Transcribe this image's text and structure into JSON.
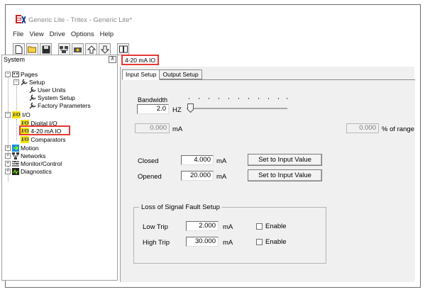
{
  "window": {
    "title": "Generic Lite - Tritex - Generic Lite*"
  },
  "menu": {
    "items": [
      "File",
      "View",
      "Drive",
      "Options",
      "Help"
    ]
  },
  "toolbar": {
    "buttons": [
      "new-icon",
      "open-folder-icon",
      "save-icon",
      "network-icon",
      "drive-icon",
      "upload-icon",
      "download-icon",
      "book-icon"
    ]
  },
  "left_pane": {
    "header": "System",
    "collapse_glyph": "⊼",
    "tree": {
      "pages": "Pages",
      "setup": "Setup",
      "user_units": "User Units",
      "system_setup": "System Setup",
      "factory_parameters": "Factory Parameters",
      "io": "I/O",
      "digital_io": "Digital I/O",
      "analog_io": "4-20 mA IO",
      "comparators": "Comparators",
      "motion": "Motion",
      "networks": "Networks",
      "monitor_control": "Monitor/Control",
      "diagnostics": "Diagnostics",
      "io_badge": "I/O"
    }
  },
  "document_tab": "4-20 mA IO",
  "tabs": {
    "input_setup": "Input Setup",
    "output_setup": "Output Setup"
  },
  "input_setup": {
    "bandwidth_label": "Bandwidth",
    "bandwidth_value": "2.0",
    "bandwidth_unit": "HZ",
    "current_value": "0.000",
    "current_unit": "mA",
    "percent_value": "0.000",
    "percent_unit": "% of range",
    "closed_label": "Closed",
    "closed_value": "4.000",
    "closed_unit": "mA",
    "opened_label": "Opened",
    "opened_value": "20.000",
    "opened_unit": "mA",
    "set_button": "Set to Input Value"
  },
  "fault_setup": {
    "title": "Loss of Signal Fault Setup",
    "low_trip_label": "Low Trip",
    "low_trip_value": "2.000",
    "high_trip_label": "High Trip",
    "high_trip_value": "30.000",
    "unit": "mA",
    "enable_label": "Enable"
  },
  "colors": {
    "highlight": "#e53935",
    "io_badge_bg": "#f5e400",
    "io_badge_fg": "#1a237e"
  }
}
